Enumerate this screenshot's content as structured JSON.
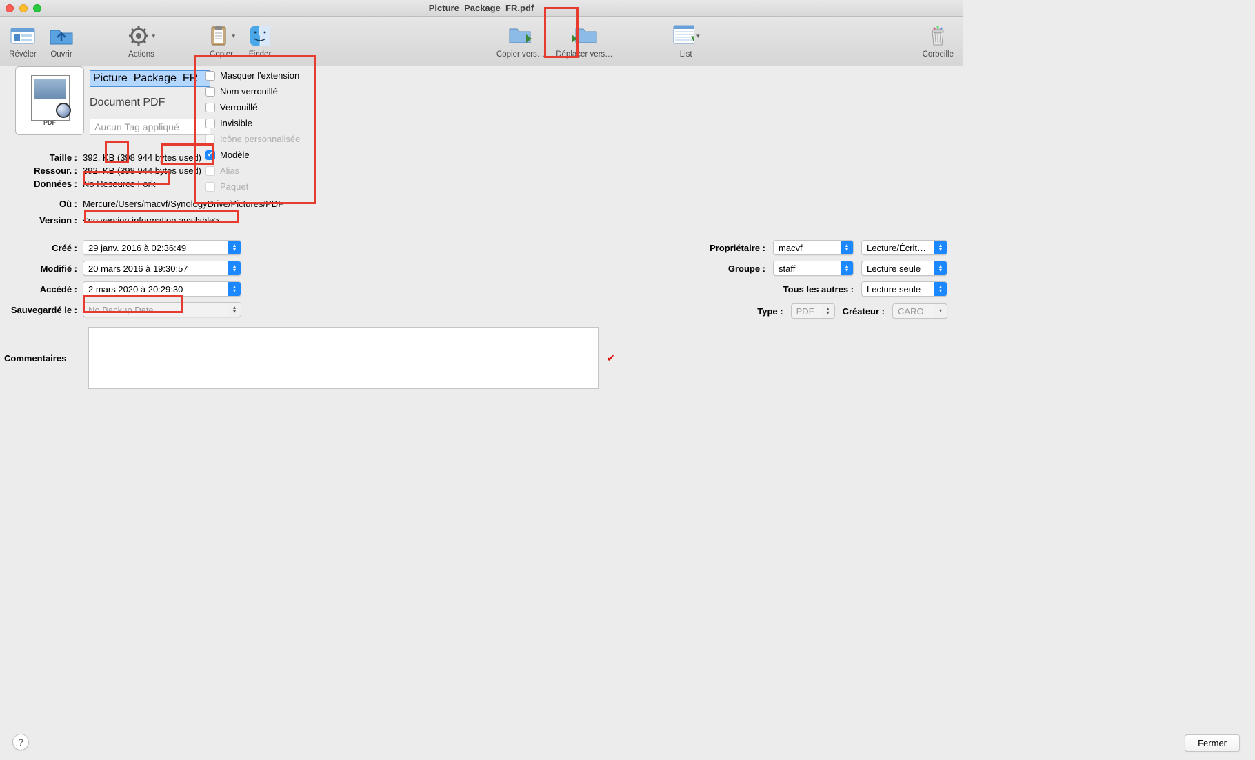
{
  "window": {
    "title": "Picture_Package_FR.pdf"
  },
  "toolbar": {
    "reveal": "Révéler",
    "open": "Ouvrir",
    "actions": "Actions",
    "copy": "Copier",
    "finder": "Finder",
    "copy_to": "Copier vers…",
    "move_to": "Déplacer vers…",
    "list": "List",
    "trash": "Corbeille"
  },
  "file": {
    "name": "Picture_Package_FR",
    "kind": "Document PDF",
    "tag_placeholder": "Aucun Tag appliqué",
    "icon_label": "PDF"
  },
  "checkboxes": {
    "hide_ext": "Masquer l'extension",
    "name_locked": "Nom verrouillé",
    "locked": "Verrouillé",
    "invisible": "Invisible",
    "custom_icon": "Icône personnalisée",
    "template": "Modèle",
    "alias": "Alias",
    "package": "Paquet"
  },
  "labels": {
    "size": "Taille :",
    "resource": "Ressour. :",
    "data": "Données :",
    "where": "Où :",
    "version": "Version :",
    "created": "Créé :",
    "modified": "Modifié :",
    "accessed": "Accédé :",
    "backup": "Sauvegardé le :",
    "owner": "Propriétaire :",
    "group": "Groupe :",
    "everyone": "Tous les autres :",
    "type": "Type :",
    "creator": "Créateur :",
    "comments": "Commentaires"
  },
  "values": {
    "size": "392, KB (398 944 bytes used)",
    "resource": "392, KB (398 944 bytes used)",
    "data": "No Resource Fork",
    "where": "Mercure/Users/macvf/SynologyDrive/Pictures/PDF",
    "version": "<no version information available>",
    "created": "29 janv. 2016 à 02:36:49",
    "modified": "20 mars 2016 à 19:30:57",
    "accessed": "2 mars 2020 à 20:29:30",
    "backup": "No Backup Date",
    "owner": "macvf",
    "group": "staff",
    "perm_owner": "Lecture/Écrit…",
    "perm_group": "Lecture seule",
    "perm_everyone": "Lecture seule",
    "type": "PDF",
    "creator": "CARO"
  },
  "buttons": {
    "close": "Fermer"
  }
}
